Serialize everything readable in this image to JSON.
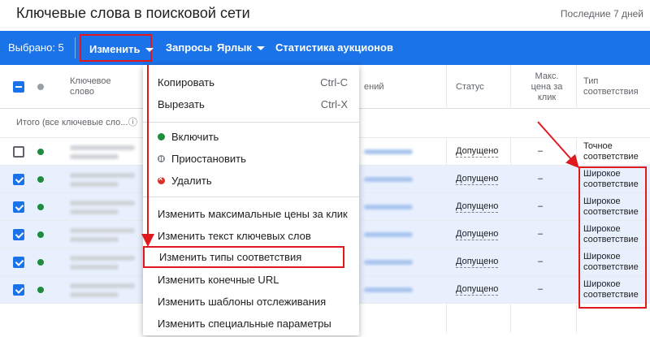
{
  "page": {
    "title": "Ключевые слова в поисковой сети",
    "date_range": "Последние 7 дней"
  },
  "toolbar": {
    "selected": "Выбрано: 5",
    "edit": "Изменить",
    "requests": "Запросы",
    "label": "Ярлык",
    "stats": "Статистика аукционов"
  },
  "table": {
    "headers": {
      "keyword": "Ключевое слово",
      "requests_partial": "ений",
      "status": "Статус",
      "max_cpc": "Макс. цена за клик",
      "match_type": "Тип соответствия"
    },
    "total": "Итого (все ключевые сло...",
    "rows": [
      {
        "status": "Допущено",
        "max_cpc": "–",
        "match_type": "Точное соответствие"
      },
      {
        "status": "Допущено",
        "max_cpc": "–",
        "match_type": "Широкое соответствие"
      },
      {
        "status": "Допущено",
        "max_cpc": "–",
        "match_type": "Широкое соответствие"
      },
      {
        "status": "Допущено",
        "max_cpc": "–",
        "match_type": "Широкое соответствие"
      },
      {
        "status": "Допущено",
        "max_cpc": "–",
        "match_type": "Широкое соответствие"
      },
      {
        "status": "Допущено",
        "max_cpc": "–",
        "match_type": "Широкое соответствие"
      }
    ]
  },
  "menu": {
    "copy": "Копировать",
    "copy_shortcut": "Ctrl-C",
    "cut": "Вырезать",
    "cut_shortcut": "Ctrl-X",
    "enable": "Включить",
    "pause": "Приостановить",
    "delete": "Удалить",
    "change_max_cpc": "Изменить максимальные цены за клик",
    "change_text": "Изменить текст ключевых слов",
    "change_match_types": "Изменить типы соответствия",
    "change_urls": "Изменить конечные URL",
    "change_tracking": "Изменить шаблоны отслеживания",
    "change_custom": "Изменить специальные параметры"
  },
  "colors": {
    "toolbar": "#1a73e8",
    "highlight": "#e0191e",
    "enabled": "#1e8e3e"
  }
}
